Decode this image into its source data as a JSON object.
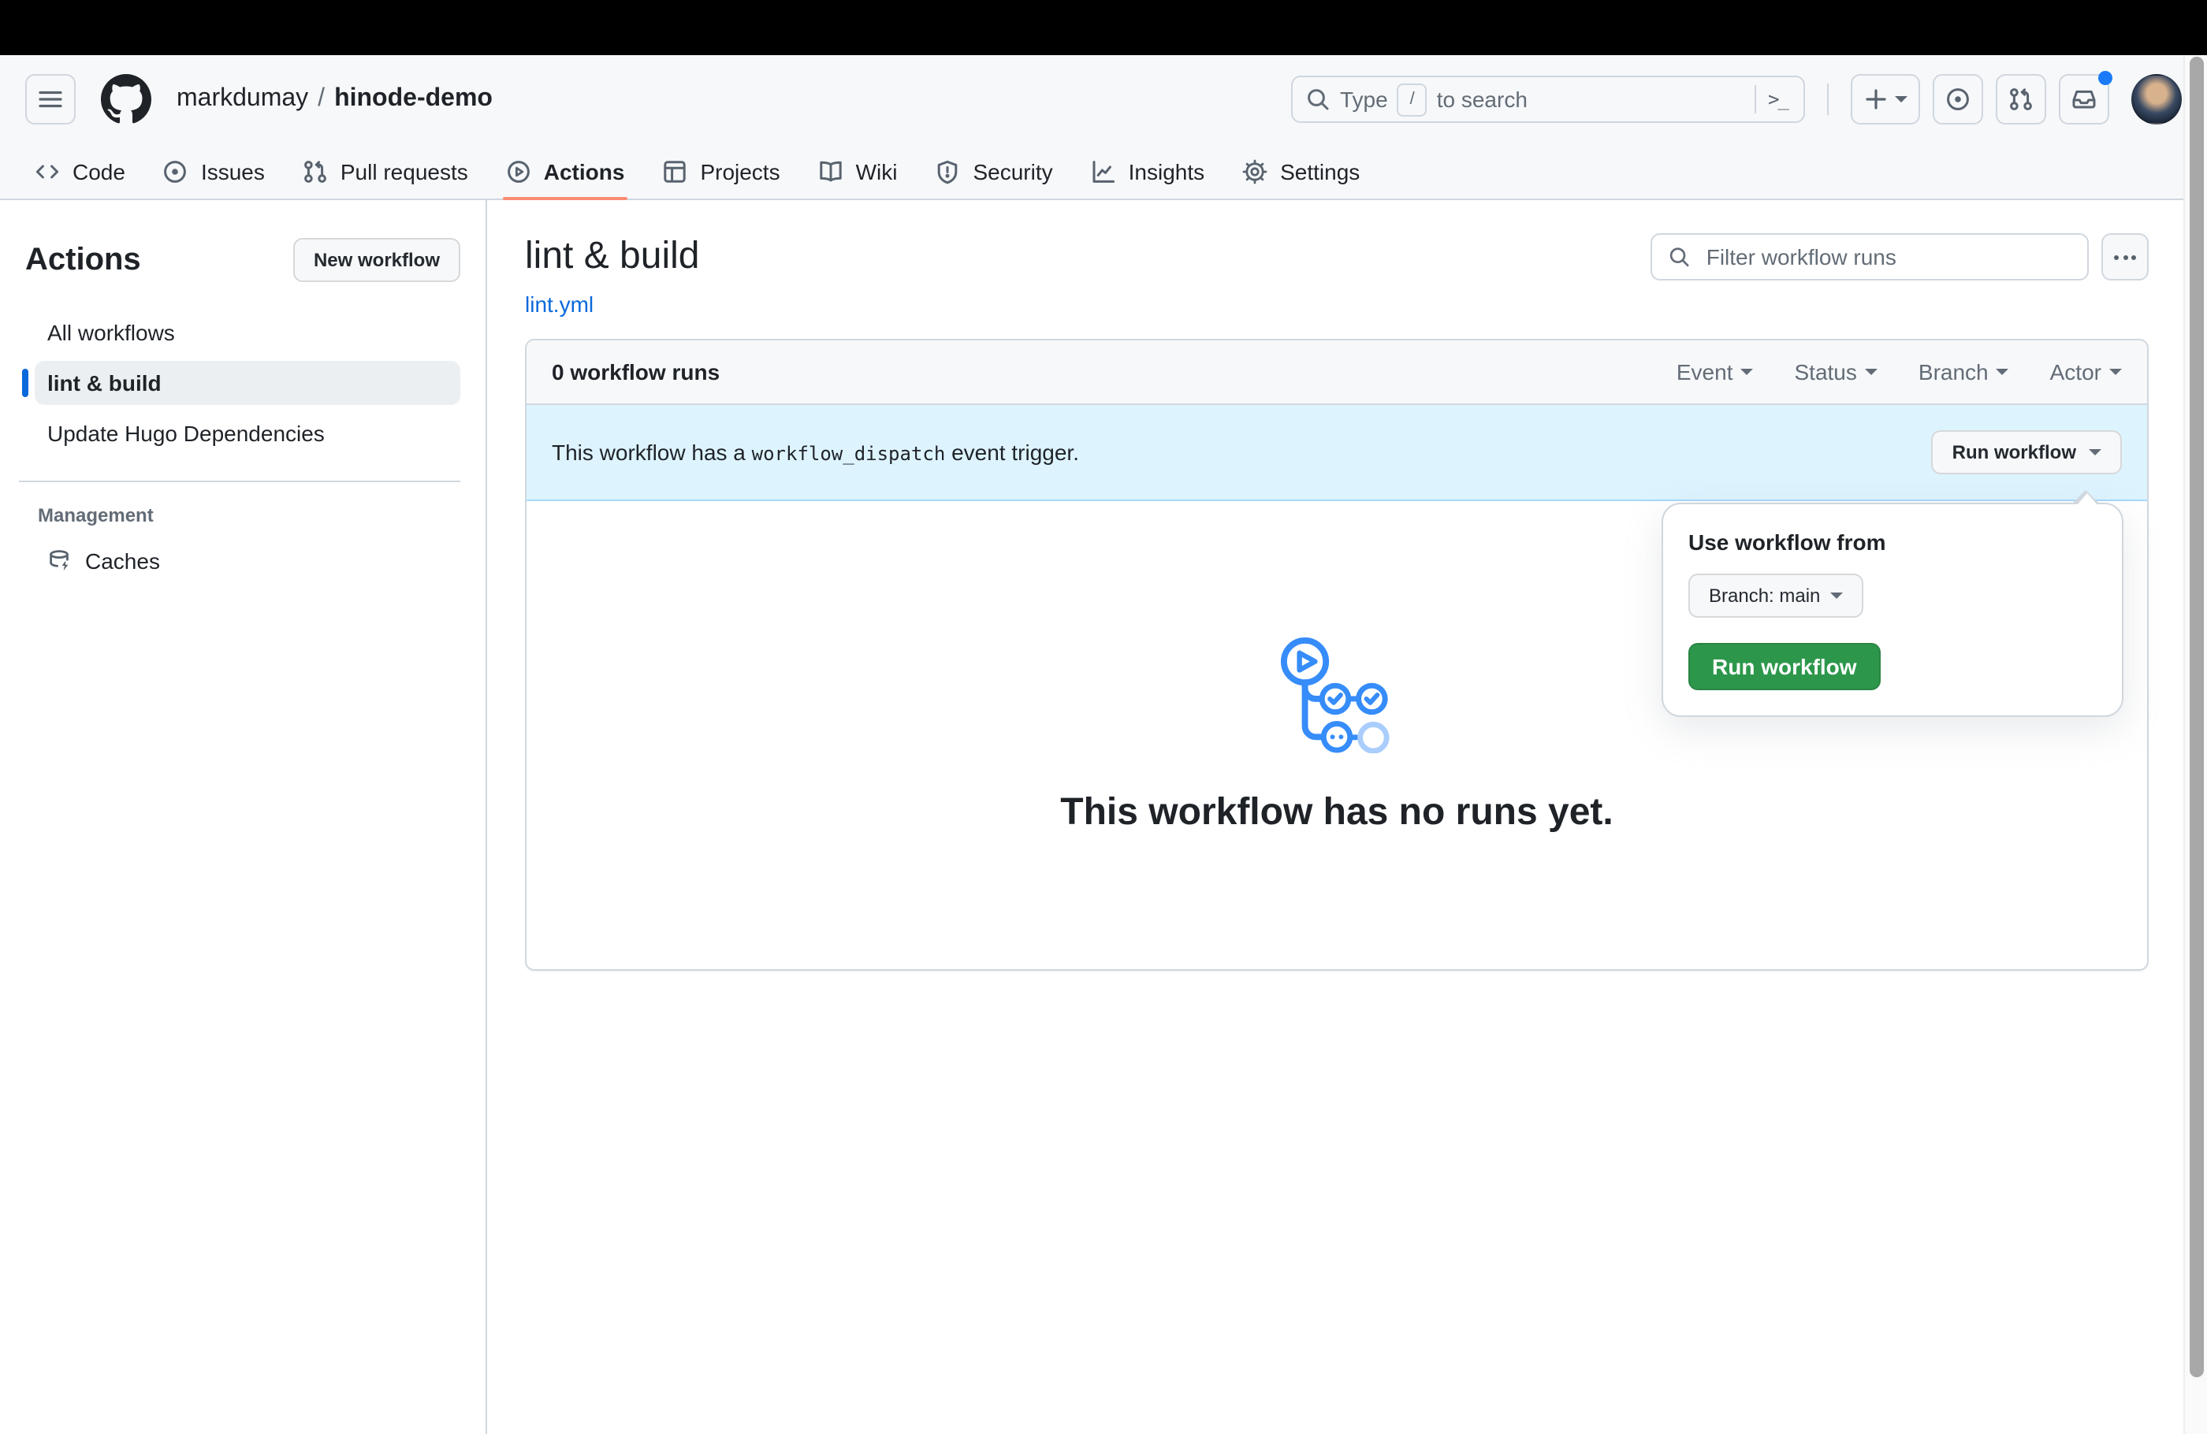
{
  "header": {
    "breadcrumb": {
      "owner": "markdumay",
      "separator": "/",
      "repo": "hinode-demo"
    },
    "search": {
      "prefix": "Type",
      "slash_key": "/",
      "suffix": "to search",
      "command_glyph": ">_"
    }
  },
  "nav": {
    "tabs": [
      {
        "label": "Code"
      },
      {
        "label": "Issues"
      },
      {
        "label": "Pull requests"
      },
      {
        "label": "Actions",
        "active": true
      },
      {
        "label": "Projects"
      },
      {
        "label": "Wiki"
      },
      {
        "label": "Security"
      },
      {
        "label": "Insights"
      },
      {
        "label": "Settings"
      }
    ]
  },
  "sidebar": {
    "title": "Actions",
    "new_workflow_button": "New workflow",
    "items": [
      {
        "label": "All workflows"
      },
      {
        "label": "lint & build",
        "selected": true
      },
      {
        "label": "Update Hugo Dependencies"
      }
    ],
    "section_title": "Management",
    "management_items": [
      {
        "label": "Caches"
      }
    ]
  },
  "main": {
    "title": "lint & build",
    "workflow_file": "lint.yml",
    "filter_placeholder": "Filter workflow runs",
    "runs_table": {
      "count_label": "0 workflow runs",
      "filters": [
        "Event",
        "Status",
        "Branch",
        "Actor"
      ]
    },
    "banner": {
      "text_before": "This workflow has a",
      "code": "workflow_dispatch",
      "text_after": "event trigger.",
      "run_workflow_button": "Run workflow"
    },
    "run_dropdown": {
      "heading": "Use workflow from",
      "branch_button": "Branch: main",
      "run_button": "Run workflow"
    },
    "empty_state": {
      "message": "This workflow has no runs yet."
    }
  },
  "colors": {
    "accent_blue": "#0969da",
    "active_tab_underline": "#fd8c73",
    "banner_background": "#ddf4ff",
    "primary_green": "#2c974b",
    "illustration_blue": "#368cf9",
    "illustration_light_blue": "#a9cdfc"
  }
}
